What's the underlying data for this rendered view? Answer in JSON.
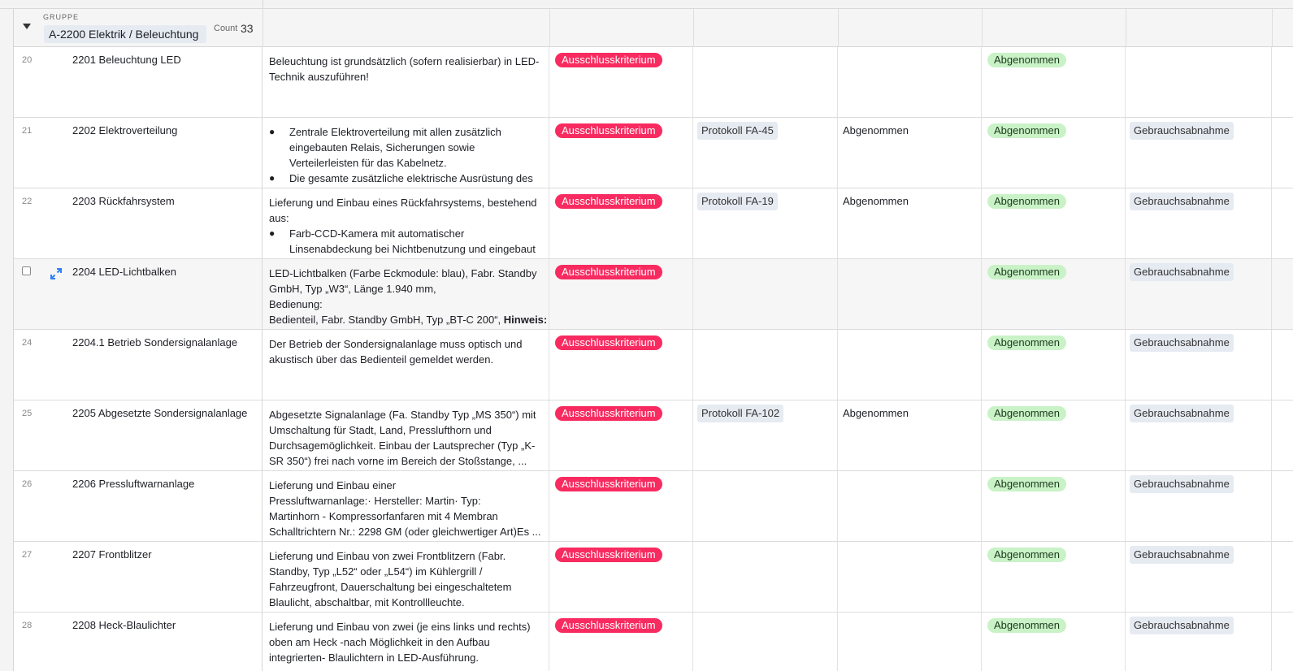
{
  "group": {
    "label": "GRUPPE",
    "name": "A-2200 Elektrik / Beleuchtung",
    "count_label": "Count",
    "count": "33"
  },
  "rows": [
    {
      "num": "20",
      "name": "2201 Beleuchtung LED",
      "desc": [
        {
          "text": "Beleuchtung ist grundsätzlich (sofern realisierbar) in LED-",
          "kind": "plain"
        },
        {
          "text": "Technik auszuführen!",
          "kind": "plain"
        }
      ],
      "kriterium": "Ausschlusskriterium",
      "protokoll": "",
      "status": "",
      "abnahme": "Abgenommen",
      "typ": ""
    },
    {
      "num": "21",
      "name": "2202 Elektroverteilung",
      "desc": [
        {
          "text": "Zentrale Elektroverteilung mit allen zusätzlich",
          "kind": "bullet"
        },
        {
          "text": "eingebauten Relais, Sicherungen sowie",
          "kind": "indent"
        },
        {
          "text": "Verteilerleisten für das Kabelnetz.",
          "kind": "indent"
        },
        {
          "text": "Die gesamte zusätzliche elektrische Ausrüstung des",
          "kind": "bullet"
        }
      ],
      "kriterium": "Ausschlusskriterium",
      "protokoll": "Protokoll FA-45",
      "status": "Abgenommen",
      "abnahme": "Abgenommen",
      "typ": "Gebrauchsabnahme"
    },
    {
      "num": "22",
      "name": "2203 Rückfahrsystem",
      "desc": [
        {
          "text": "Lieferung und Einbau eines Rückfahrsystems, bestehend",
          "kind": "plain"
        },
        {
          "text": "aus:",
          "kind": "plain"
        },
        {
          "text": "Farb-CCD-Kamera mit automatischer",
          "kind": "bullet"
        },
        {
          "text": "Linsenabdeckung bei Nichtbenutzung und eingebaut",
          "kind": "indent"
        }
      ],
      "kriterium": "Ausschlusskriterium",
      "protokoll": "Protokoll FA-19",
      "status": "Abgenommen",
      "abnahme": "Abgenommen",
      "typ": "Gebrauchsabnahme"
    },
    {
      "num": "",
      "hover": true,
      "name": "2204 LED-Lichtbalken",
      "desc": [
        {
          "text": "LED-Lichtbalken (Farbe Eckmodule: blau), Fabr. Standby",
          "kind": "plain"
        },
        {
          "text": "GmbH, Typ „W3“, Länge 1.940 mm,",
          "kind": "plain"
        },
        {
          "text": "Bedienung:",
          "kind": "plain"
        },
        {
          "text": "Bedienteil, Fabr. Standby GmbH, Typ „BT-C 200“, ",
          "bold": "Hinweis:",
          "kind": "plain"
        }
      ],
      "kriterium": "Ausschlusskriterium",
      "protokoll": "",
      "status": "",
      "abnahme": "Abgenommen",
      "typ": "Gebrauchsabnahme"
    },
    {
      "num": "24",
      "name": "2204.1 Betrieb Sondersignalanlage",
      "desc": [
        {
          "text": "Der Betrieb der Sondersignalanlage muss optisch und",
          "kind": "plain"
        },
        {
          "text": "akustisch über das Bedienteil gemeldet werden.",
          "kind": "plain"
        }
      ],
      "kriterium": "Ausschlusskriterium",
      "protokoll": "",
      "status": "",
      "abnahme": "Abgenommen",
      "typ": "Gebrauchsabnahme"
    },
    {
      "num": "25",
      "name": "2205 Abgesetzte Sondersignalanlage",
      "desc": [
        {
          "text": "Abgesetzte Signalanlage (Fa. Standby Typ „MS 350“) mit",
          "kind": "plain"
        },
        {
          "text": "Umschaltung für Stadt, Land, Pressluft­horn und",
          "kind": "plain"
        },
        {
          "text": "Durchsagemöglichkeit. Einbau der Lautsprecher (Typ „K-",
          "kind": "plain"
        },
        {
          "text": "SR 350“) frei nach vorne im Bereich der Stoßstange, ...",
          "kind": "plain"
        }
      ],
      "kriterium": "Ausschlusskriterium",
      "protokoll": "Protokoll FA-102",
      "status": "Abgenommen",
      "abnahme": "Abgenommen",
      "typ": "Gebrauchsabnahme"
    },
    {
      "num": "26",
      "name": "2206 Pressluftwarnanlage",
      "desc": [
        {
          "text": "Lieferung und Einbau einer",
          "kind": "plain"
        },
        {
          "text": "Pressluftwarnanlage:·    Hersteller: Martin·    Typ:",
          "kind": "plain"
        },
        {
          "text": "Martinhorn - Kompressorfanfaren mit 4 Membran",
          "kind": "plain"
        },
        {
          "text": "Schalltrichtern Nr.: 2298 GM (oder gleichwertiger Art)Es ...",
          "kind": "plain"
        }
      ],
      "kriterium": "Ausschlusskriterium",
      "protokoll": "",
      "status": "",
      "abnahme": "Abgenommen",
      "typ": "Gebrauchsabnahme"
    },
    {
      "num": "27",
      "name": "2207 Frontblitzer",
      "desc": [
        {
          "text": "Lieferung und Einbau von zwei Frontblitzern (Fabr.",
          "kind": "plain"
        },
        {
          "text": "Standby, Typ „L52“ oder „L54“) im Kühlergrill /",
          "kind": "plain"
        },
        {
          "text": "Fahrzeugfront, Dauerschaltung bei eingeschaltetem",
          "kind": "plain"
        },
        {
          "text": "Blaulicht, abschaltbar, mit Kontrollleuchte.",
          "kind": "plain"
        }
      ],
      "kriterium": "Ausschlusskriterium",
      "protokoll": "",
      "status": "",
      "abnahme": "Abgenommen",
      "typ": "Gebrauchsabnahme"
    },
    {
      "num": "28",
      "name": "2208 Heck-Blaulichter",
      "desc": [
        {
          "text": "Lieferung und Einbau von zwei (je eins links und rechts)",
          "kind": "plain"
        },
        {
          "text": "oben am Heck -nach Möglichkeit in den Aufbau",
          "kind": "plain"
        },
        {
          "text": "integrierten- Blaulichtern in LED-Ausführung.",
          "kind": "plain"
        }
      ],
      "kriterium": "Ausschlusskriterium",
      "protokoll": "",
      "status": "",
      "abnahme": "Abgenommen",
      "typ": "Gebrauchsabnahme"
    }
  ],
  "colors": {
    "kriterium_pill": "#f82b60",
    "abnahme_pill": "#c9f2c7",
    "tag_bg": "#e6ebf2",
    "expand_icon": "#2d7ff9"
  },
  "icons": {
    "group_toggle": "caret-down-icon",
    "expand_record": "expand-arrows-icon",
    "drag_handle": "drag-handle-icon"
  }
}
